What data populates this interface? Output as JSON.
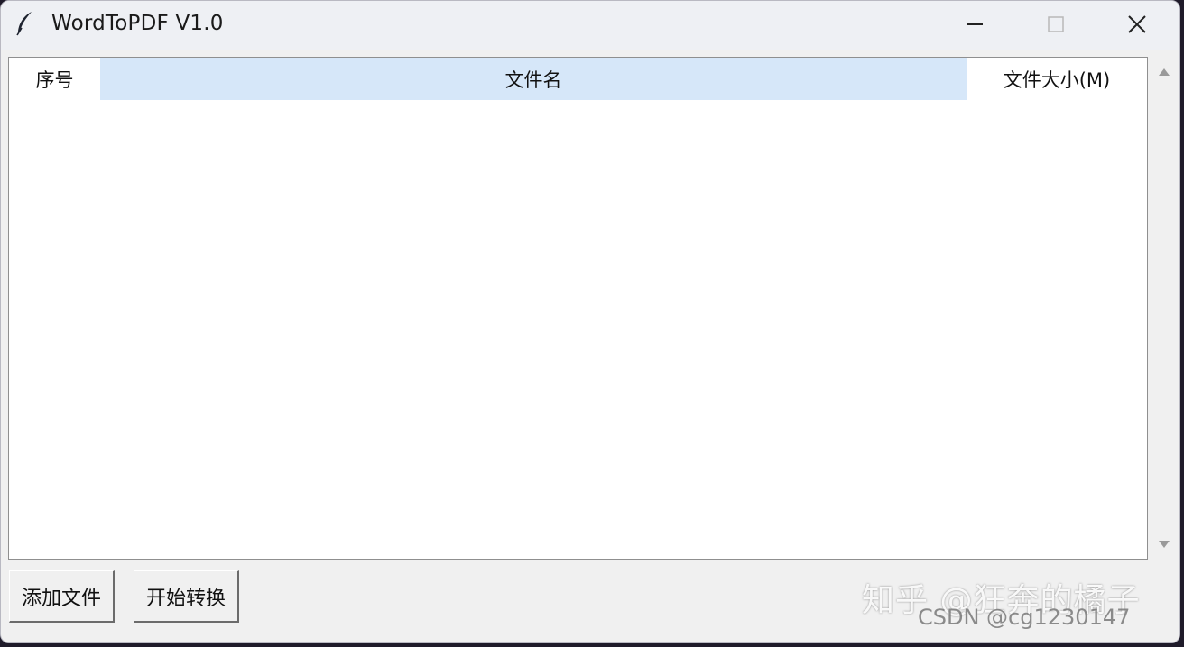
{
  "window": {
    "title": "WordToPDF V1.0",
    "icon": "feather-icon"
  },
  "titlebar_controls": {
    "minimize": "minimize-icon",
    "maximize": "maximize-icon",
    "close": "close-icon"
  },
  "table": {
    "columns": [
      {
        "label": "序号"
      },
      {
        "label": "文件名"
      },
      {
        "label": "文件大小(M)"
      }
    ],
    "rows": []
  },
  "buttons": {
    "add_file": "添加文件",
    "start_convert": "开始转换"
  },
  "watermark": {
    "line1": "知乎 @狂奔的橘子",
    "line2": "CSDN @cg1230147"
  },
  "colors": {
    "header_selected": "#d6e7f9",
    "window_bg": "#f0f0f0"
  }
}
